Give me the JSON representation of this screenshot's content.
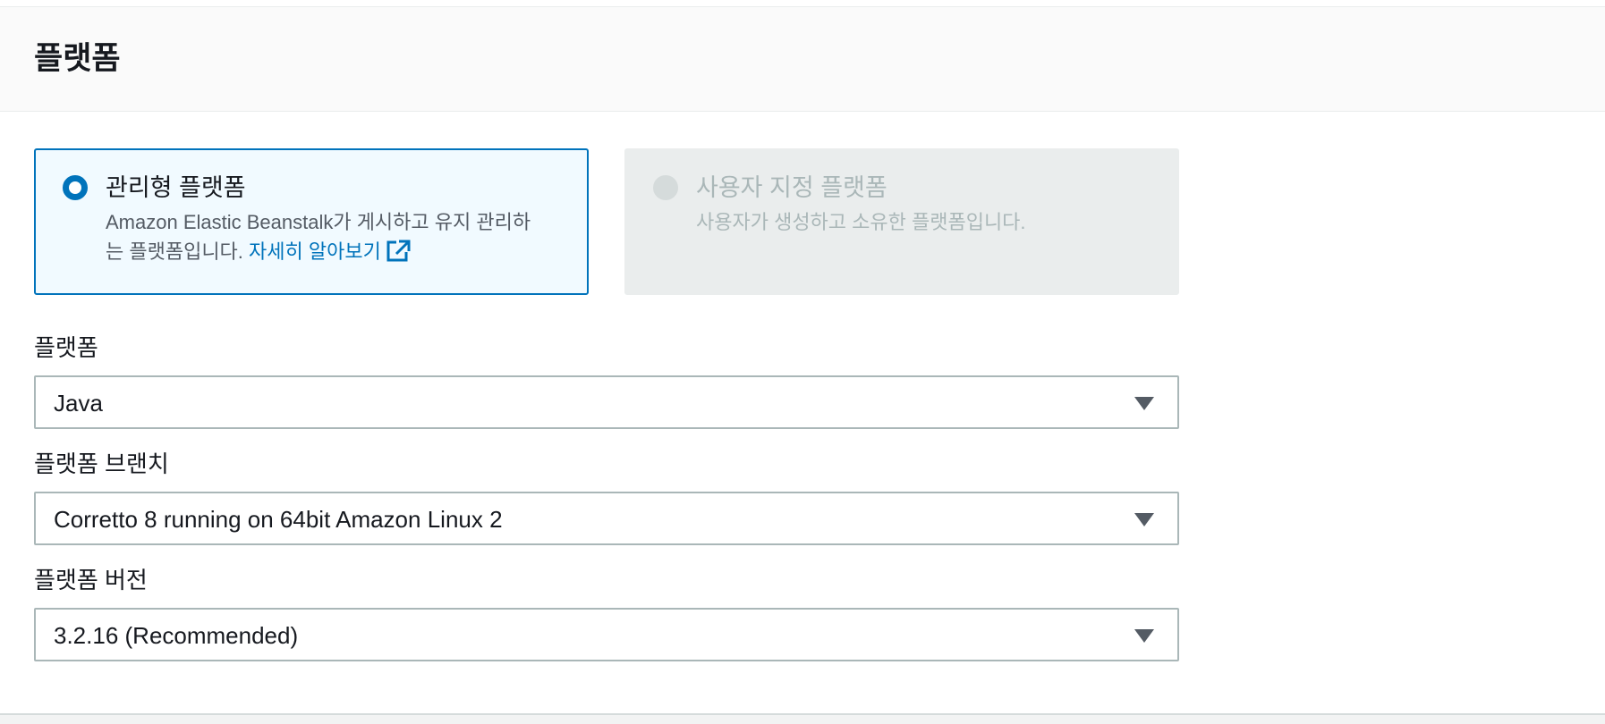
{
  "panel": {
    "title": "플랫폼"
  },
  "platform_type": {
    "managed": {
      "title": "관리형 플랫폼",
      "desc_line1": "Amazon Elastic Beanstalk가 게시하고 유지 관리하",
      "desc_line2": "는 플랫폼입니다.",
      "learn_more": "자세히 알아보기",
      "selected": true
    },
    "custom": {
      "title": "사용자 지정 플랫폼",
      "desc": "사용자가 생성하고 소유한 플랫폼입니다.",
      "disabled": true
    }
  },
  "fields": {
    "platform": {
      "label": "플랫폼",
      "value": "Java"
    },
    "platform_branch": {
      "label": "플랫폼 브랜치",
      "value": "Corretto 8 running on 64bit Amazon Linux 2"
    },
    "platform_version": {
      "label": "플랫폼 버전",
      "value": "3.2.16 (Recommended)"
    }
  },
  "colors": {
    "accent": "#0073bb",
    "selected_bg": "#f1faff",
    "disabled_bg": "#eaeded",
    "muted_text": "#aab7b8"
  },
  "icons": {
    "learn_more": "external-link-icon",
    "select": "caret-down-icon"
  }
}
